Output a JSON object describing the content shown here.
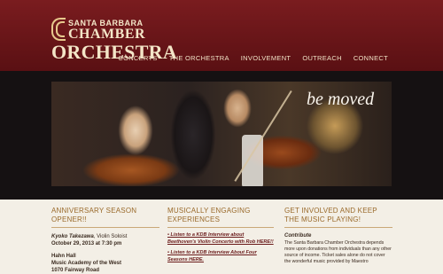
{
  "header": {
    "logo": {
      "line1": "SANTA BARBARA",
      "line2": "CHAMBER",
      "line3": "ORCHESTRA"
    },
    "nav": [
      "CONCERTS",
      "THE ORCHESTRA",
      "INVOLVEMENT",
      "OUTREACH",
      "CONNECT"
    ]
  },
  "hero": {
    "tagline": "be moved"
  },
  "col1": {
    "heading": "ANNIVERSARY SEASON OPENER!!",
    "soloist_name": "Kyoko Takezawa",
    "soloist_role": ", Violin Soloist",
    "date": "October 29, 2013 at 7:30 pm",
    "venue1": "Hahn Hall",
    "venue2": "Music Academy of the West",
    "venue3": "1070 Fairway Road"
  },
  "col2": {
    "heading": "MUSICALLY ENGAGING EXPERIENCES",
    "link1": "Listen to a KDB Interview about Beethoven's Violin Concerto with Rob HERE!!",
    "link2": "Listen to a KDB Interview About Four Seasons HERE."
  },
  "col3": {
    "heading": "GET INVOLVED AND KEEP THE MUSIC PLAYING!",
    "subheading": "Contribute",
    "body": "The Santa Barbara Chamber Orchestra depends more upon donations from individuals than any other source of income. Ticket sales alone do not cover the wonderful music provided by Maestro"
  }
}
